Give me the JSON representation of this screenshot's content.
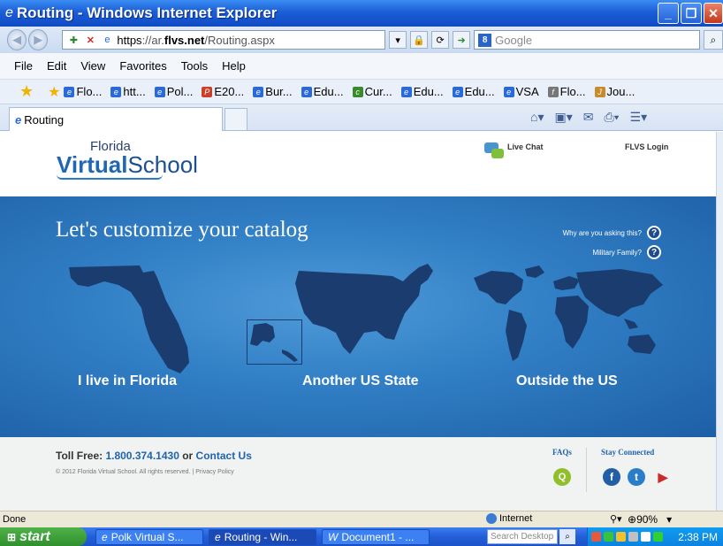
{
  "window": {
    "title": "Routing - Windows Internet Explorer",
    "controls": {
      "minimize": "_",
      "maximize": "❐",
      "close": "✕"
    }
  },
  "address_bar": {
    "scheme": "https",
    "separator": "://",
    "subdomain": "ar.",
    "host": "flvs.net",
    "path": "/Routing.aspx",
    "search_engine_label": "8",
    "search_placeholder": "Google"
  },
  "menu": [
    "File",
    "Edit",
    "View",
    "Favorites",
    "Tools",
    "Help"
  ],
  "favorites": [
    "Flo...",
    "htt...",
    "Pol...",
    "E20...",
    "Bur...",
    "Edu...",
    "Cur...",
    "Edu...",
    "Edu...",
    "VSA",
    "Flo...",
    "Jou..."
  ],
  "tab": {
    "label": "Routing"
  },
  "header": {
    "logo_top": "Florida",
    "logo_bold": "Virtual",
    "logo_rest": "School",
    "live_chat": "Live Chat",
    "login": "FLVS Login"
  },
  "hero": {
    "title": "Let's customize your catalog",
    "why_asking": "Why are you asking this?",
    "military": "Military Family?",
    "qmark": "?",
    "choices": {
      "florida": "I live in Florida",
      "us_state": "Another US State",
      "outside": "Outside the US"
    }
  },
  "footer": {
    "toll_label": "Toll Free: ",
    "toll_number": "1.800.374.1430",
    "or": " or ",
    "contact": "Contact Us",
    "copyright": "© 2012 Florida Virtual School. All rights reserved.   |   Privacy Policy",
    "faqs": "FAQs",
    "faq_icon": "Q",
    "stay_connected": "Stay Connected",
    "facebook": "f",
    "twitter": "t",
    "youtube": "▶"
  },
  "status": {
    "text": "Done",
    "zone": "Internet",
    "zoom": "90%"
  },
  "taskbar": {
    "start": "start",
    "tasks": [
      "Polk Virtual S...",
      "Routing - Win...",
      "Document1 - ..."
    ],
    "search_placeholder": "Search Desktop",
    "clock": "2:38 PM"
  },
  "colors": {
    "hero_blue": "#3280c6",
    "link_blue": "#1f64b0",
    "title_bar": "#1b5ed6"
  }
}
